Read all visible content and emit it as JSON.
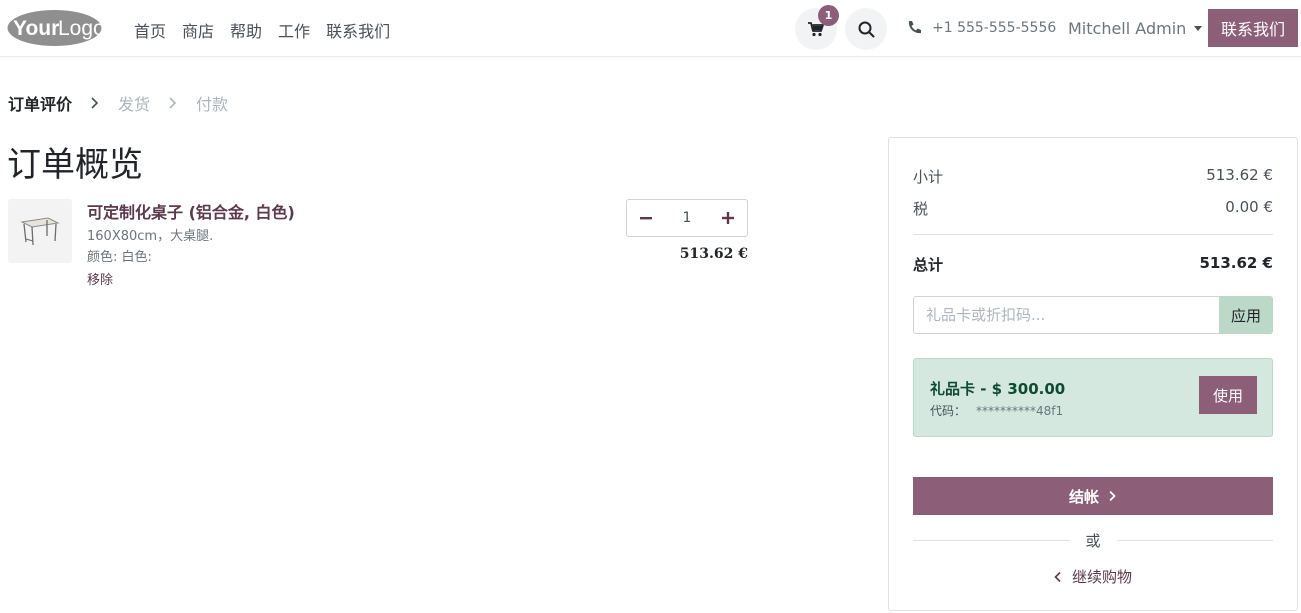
{
  "header": {
    "logo_text": "YourLogo",
    "nav": [
      "首页",
      "商店",
      "帮助",
      "工作",
      "联系我们"
    ],
    "cart_count": "1",
    "phone": "+1 555-555-5556",
    "user": "Mitchell Admin",
    "contact_label": "联系我们"
  },
  "breadcrumb": {
    "steps": [
      "订单评价",
      "发货",
      "付款"
    ]
  },
  "page_title": "订单概览",
  "product": {
    "name": "可定制化桌子 (铝合金, 白色)",
    "description": "160X80cm，大桌腿.",
    "attribute": "颜色: 白色:",
    "remove_label": "移除",
    "quantity": "1",
    "price": "513.62 €"
  },
  "summary": {
    "subtotal_label": "小计",
    "subtotal_value": "513.62 €",
    "tax_label": "税",
    "tax_value": "0.00 €",
    "total_label": "总计",
    "total_value": "513.62 €",
    "promo_placeholder": "礼品卡或折扣码...",
    "promo_button": "应用",
    "gift_title": "礼品卡 - $ 300.00",
    "gift_code_label": "代码：",
    "gift_code_value": "**********48f1",
    "gift_button": "使用",
    "checkout_label": "结帐",
    "or_text": "或",
    "continue_label": "继续购物"
  },
  "colors": {
    "brand": "#8d5e77",
    "promo_button": "#bcd8c8",
    "gift_bg": "#d4e8df"
  }
}
